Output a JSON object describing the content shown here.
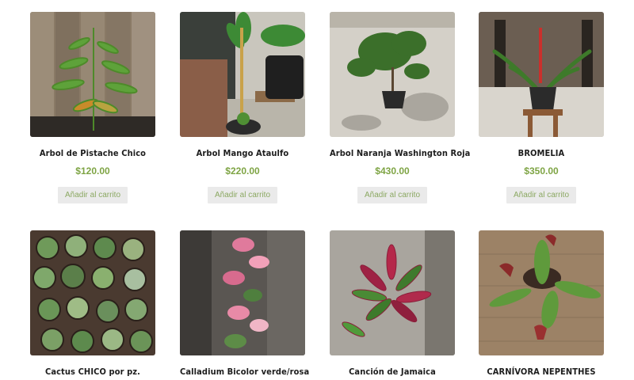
{
  "products": [
    {
      "name": "Arbol de Pistache Chico",
      "price": "$120.00",
      "button": "Añadir al carrito"
    },
    {
      "name": "Arbol Mango Ataulfo",
      "price": "$220.00",
      "button": "Añadir al carrito"
    },
    {
      "name": "Arbol Naranja Washington Roja",
      "price": "$430.00",
      "button": "Añadir al carrito"
    },
    {
      "name": "BROMELIA",
      "price": "$350.00",
      "button": "Añadir al carrito"
    },
    {
      "name": "Cactus CHICO por pz.",
      "price": "",
      "button": ""
    },
    {
      "name": "Calladium Bicolor verde/rosa",
      "price": "",
      "button": ""
    },
    {
      "name": "Canción de Jamaica",
      "price": "",
      "button": ""
    },
    {
      "name": "CARNÍVORA NEPENTHES",
      "price": "",
      "button": ""
    }
  ],
  "colors": {
    "price": "#7ea444",
    "button_bg": "#eaeaea",
    "button_text": "#8ba862"
  }
}
